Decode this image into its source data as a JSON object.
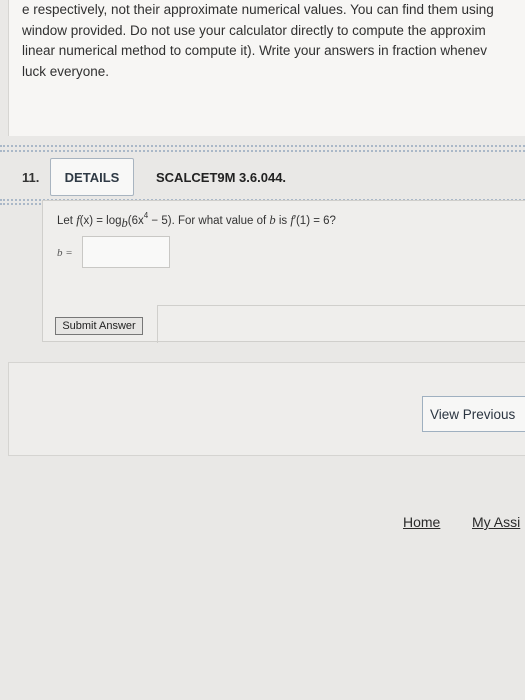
{
  "intro": {
    "lines": [
      "e respectively, not their approximate numerical values. You can find them using",
      "window provided. Do not use your calculator directly to compute the approxim",
      "linear numerical method to compute it). Write your answers in fraction whenev",
      "luck everyone."
    ]
  },
  "question": {
    "number": "11.",
    "details_label": "DETAILS",
    "code": "SCALCET9M 3.6.044.",
    "prompt": {
      "p1": "Let ",
      "f1": "f",
      "p2": "(x) = log",
      "base": "b",
      "p3": "(6x",
      "exp": "4",
      "p4": " − 5). For what value of ",
      "b": "b",
      "p5": " is ",
      "f2": "f",
      "p6": "′(1) = 6?"
    },
    "answer_label": "b =",
    "answer_value": "",
    "submit_label": "Submit Answer"
  },
  "nav": {
    "view_previous_label": "View Previous",
    "home_label": "Home",
    "my_assignments_label": "My Assi"
  }
}
